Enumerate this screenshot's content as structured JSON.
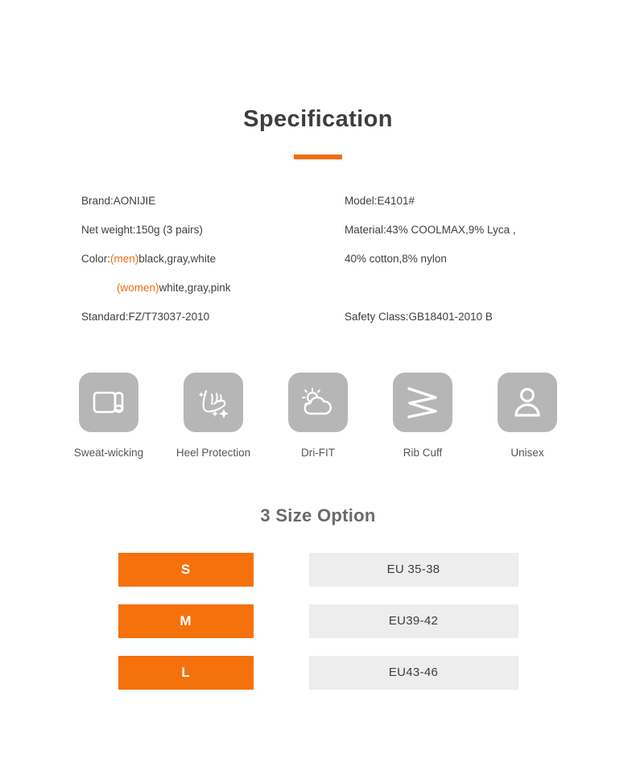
{
  "header": {
    "title": "Specification",
    "accent_color": "#ef6c11"
  },
  "spec": {
    "left": [
      {
        "label": "Brand:",
        "value": "AONIJIE"
      },
      {
        "label": "Net weight:",
        "value": "150g (3 pairs)"
      },
      {
        "label": "Color:",
        "highlight": "(men)",
        "value": "black,gray,white"
      },
      {
        "label": "",
        "highlight": "(women)",
        "value": "white,gray,pink"
      },
      {
        "label": "Standard:",
        "value": "FZ/T73037-2010"
      }
    ],
    "right": [
      {
        "label": "Model:",
        "value": "E4101#"
      },
      {
        "label": "Material:",
        "value": "43% COOLMAX,9% Lyca ,"
      },
      {
        "label": "",
        "value": "40% cotton,8% nylon"
      },
      {
        "label": "",
        "value": ""
      },
      {
        "label": "Safety Class:",
        "value": "GB18401-2010 B"
      }
    ],
    "left_lines": {
      "l1": "Brand:AONIJIE",
      "l2": "Net weight:150g (3 pairs)",
      "l3_prefix": "Color:",
      "l3_tag": "(men)",
      "l3_rest": "black,gray,white",
      "l4_tag": "(women)",
      "l4_rest": "white,gray,pink",
      "l5": "Standard:FZ/T73037-2010"
    },
    "right_lines": {
      "r1": "Model:E4101#",
      "r2": "Material:43% COOLMAX,9% Lyca ,",
      "r3": "40% cotton,8% nylon",
      "r4": "Safety Class:GB18401-2010 B"
    }
  },
  "features": [
    {
      "icon": "fabric-roll-icon",
      "label": "Sweat-wicking"
    },
    {
      "icon": "foot-sparkle-icon",
      "label": "Heel Protection"
    },
    {
      "icon": "sun-cloud-icon",
      "label": "Dri-FIT"
    },
    {
      "icon": "zigzag-icon",
      "label": "Rib Cuff"
    },
    {
      "icon": "person-icon",
      "label": "Unisex"
    }
  ],
  "sizes": {
    "title": "3 Size Option",
    "rows": [
      {
        "size": "S",
        "eu": "EU 35-38"
      },
      {
        "size": "M",
        "eu": "EU39-42"
      },
      {
        "size": "L",
        "eu": "EU43-46"
      }
    ]
  },
  "colors": {
    "orange": "#f5710c",
    "tile_gray": "#b6b6b6",
    "chip_gray": "#ededed"
  }
}
